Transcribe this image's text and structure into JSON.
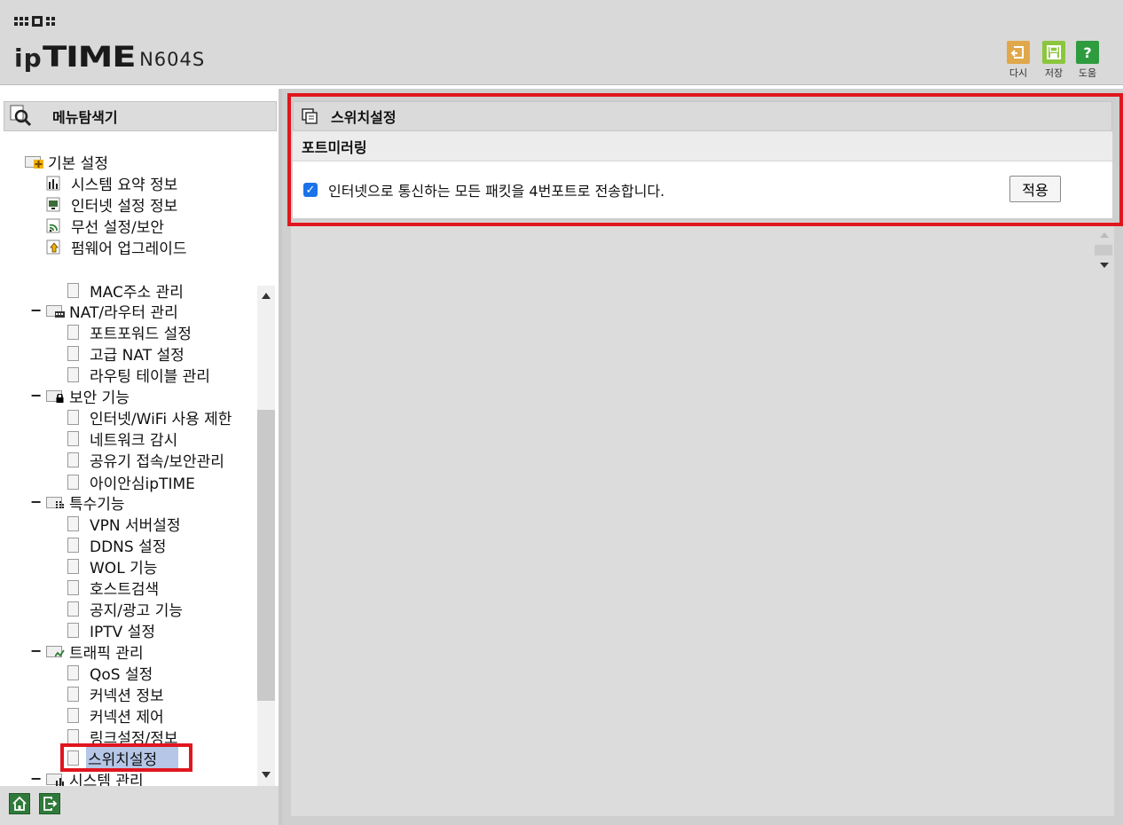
{
  "header": {
    "model": "N604S",
    "brand_prefix": "ip",
    "brand_main": "TIME",
    "buttons": [
      {
        "label": "다시",
        "icon": "undo-icon",
        "color": "#e0a84a"
      },
      {
        "label": "저장",
        "icon": "save-icon",
        "color": "#8cc63e"
      },
      {
        "label": "도움",
        "icon": "help-icon",
        "color": "#2f9b3f"
      }
    ]
  },
  "sidebar": {
    "title": "메뉴탐색기",
    "basic_group": {
      "label": "기본 설정",
      "items": [
        "시스템 요약 정보",
        "인터넷 설정 정보",
        "무선 설정/보안",
        "펌웨어 업그레이드"
      ]
    },
    "tree": {
      "partial_top": "MAC주소 관리",
      "nat": {
        "label": "NAT/라우터 관리",
        "items": [
          "포트포워드 설정",
          "고급 NAT 설정",
          "라우팅 테이블 관리"
        ]
      },
      "security": {
        "label": "보안 기능",
        "items": [
          "인터넷/WiFi 사용 제한",
          "네트워크 감시",
          "공유기 접속/보안관리",
          "아이안심ipTIME"
        ]
      },
      "special": {
        "label": "특수기능",
        "items": [
          "VPN 서버설정",
          "DDNS 설정",
          "WOL 기능",
          "호스트검색",
          "공지/광고 기능",
          "IPTV 설정"
        ]
      },
      "traffic": {
        "label": "트래픽 관리",
        "items": [
          "QoS 설정",
          "커넥션 정보",
          "커넥션 제어",
          "링크설정/정보",
          "스위치설정"
        ]
      },
      "system": {
        "label": "시스템 관리"
      }
    },
    "selected_item": "스위치설정"
  },
  "main": {
    "panel_title": "스위치설정",
    "section_title": "포트미러링",
    "mirroring_option": {
      "checked": true,
      "label": "인터넷으로 통신하는 모든 패킷을 4번포트로 전송합니다."
    },
    "apply_label": "적용"
  },
  "colors": {
    "highlight_red": "#e0161e",
    "selection_bg": "#b5c6e6"
  }
}
